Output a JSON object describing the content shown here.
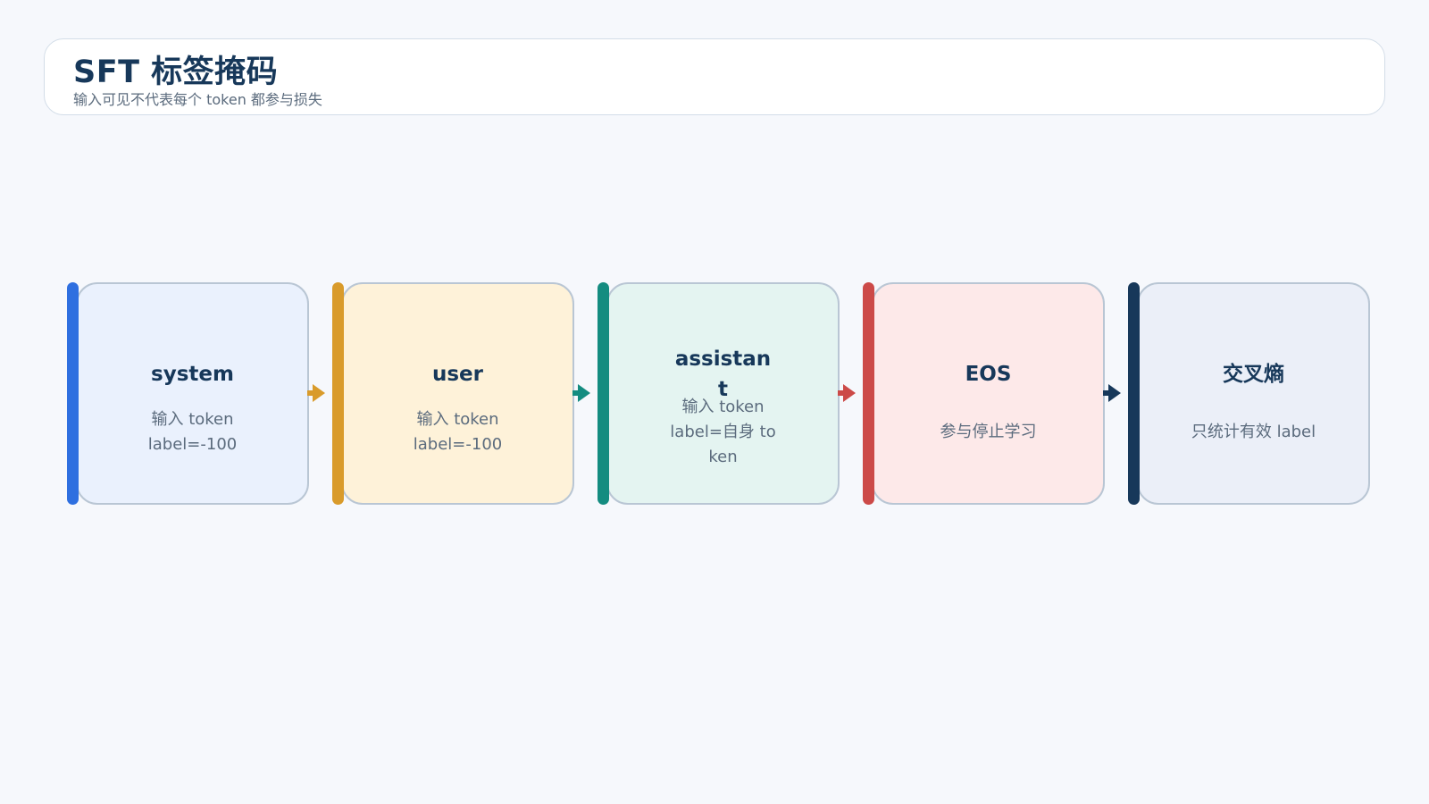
{
  "header": {
    "title": "SFT 标签掩码",
    "subtitle": "输入可见不代表每个 token 都参与损失"
  },
  "steps": [
    {
      "title": "system",
      "desc_line1": "输入 token",
      "desc_line2": "label=-100",
      "accent": "#2e6fe0",
      "bg": "#eaf1fd"
    },
    {
      "title": "user",
      "desc_line1": "输入 token",
      "desc_line2": "label=-100",
      "accent": "#d99b2b",
      "bg": "#fef2d9"
    },
    {
      "title_line1": "assistan",
      "title_line2": "t",
      "desc_line1": "输入 token",
      "desc_line2": "label=自身 to",
      "desc_line3": "ken",
      "accent": "#148c80",
      "bg": "#e4f4f1"
    },
    {
      "title": "EOS",
      "desc_line1": "参与停止学习",
      "accent": "#cc4a48",
      "bg": "#fde9e9"
    },
    {
      "title": "交叉熵",
      "desc_line1": "只统计有效 label",
      "accent": "#17385a",
      "bg": "#ebeff8"
    }
  ]
}
